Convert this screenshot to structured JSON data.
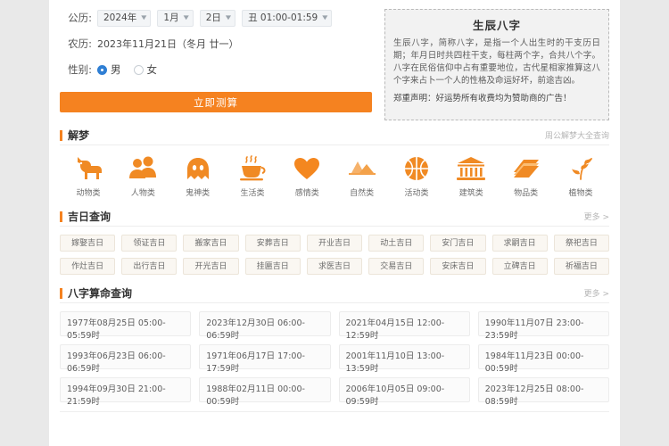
{
  "form": {
    "solar_label": "公历:",
    "year": "2024年",
    "month": "1月",
    "day": "2日",
    "hour": "丑 01:00-01:59",
    "lunar_label": "农历:",
    "lunar_value": "2023年11月21日（冬月 廿一）",
    "gender_label": "性别:",
    "gender_male": "男",
    "gender_female": "女",
    "gender_selected": "男",
    "submit_label": "立即测算",
    "caret": "▼"
  },
  "info": {
    "title": "生辰八字",
    "body": "生辰八字，简称八字，是指一个人出生时的干支历日期；年月日时共四柱干支，每柱两个字，合共八个字。八字在民俗信仰中占有重要地位，古代星相家推算这八个字来占卜一个人的性格及命运好坏，前途吉凶。",
    "note": "郑重声明：好运势所有收费均为赞助商的广告！",
    "accent": "#f58220"
  },
  "dream": {
    "title": "解梦",
    "more": "周公解梦大全查询",
    "items": [
      {
        "label": "动物类",
        "icon": "dog-icon"
      },
      {
        "label": "人物类",
        "icon": "people-icon"
      },
      {
        "label": "鬼神类",
        "icon": "ghost-icon"
      },
      {
        "label": "生活类",
        "icon": "teacup-icon"
      },
      {
        "label": "感情类",
        "icon": "heart-icon"
      },
      {
        "label": "自然类",
        "icon": "mountain-icon"
      },
      {
        "label": "活动类",
        "icon": "basketball-icon"
      },
      {
        "label": "建筑类",
        "icon": "building-icon"
      },
      {
        "label": "物品类",
        "icon": "books-icon"
      },
      {
        "label": "植物类",
        "icon": "plant-icon"
      }
    ]
  },
  "luckyday": {
    "title": "吉日查询",
    "more": "更多 >",
    "tags": [
      "嫁娶吉日",
      "领证吉日",
      "搬家吉日",
      "安葬吉日",
      "开业吉日",
      "动土吉日",
      "安门吉日",
      "求嗣吉日",
      "祭祀吉日",
      "作灶吉日",
      "出行吉日",
      "开光吉日",
      "挂匾吉日",
      "求医吉日",
      "交易吉日",
      "安床吉日",
      "立碑吉日",
      "祈福吉日"
    ]
  },
  "bazi": {
    "title": "八字算命查询",
    "more": "更多 >",
    "cards": [
      "1977年08月25日 05:00-05:59时",
      "2023年12月30日 06:00-06:59时",
      "2021年04月15日 12:00-12:59时",
      "1990年11月07日 23:00-23:59时",
      "1993年06月23日 06:00-06:59时",
      "1971年06月17日 17:00-17:59时",
      "2001年11月10日 13:00-13:59时",
      "1984年11月23日 00:00-00:59时",
      "1994年09月30日 21:00-21:59时",
      "1988年02月11日 00:00-00:59时",
      "2006年10月05日 09:00-09:59时",
      "2023年12月25日 08:00-08:59时"
    ]
  }
}
